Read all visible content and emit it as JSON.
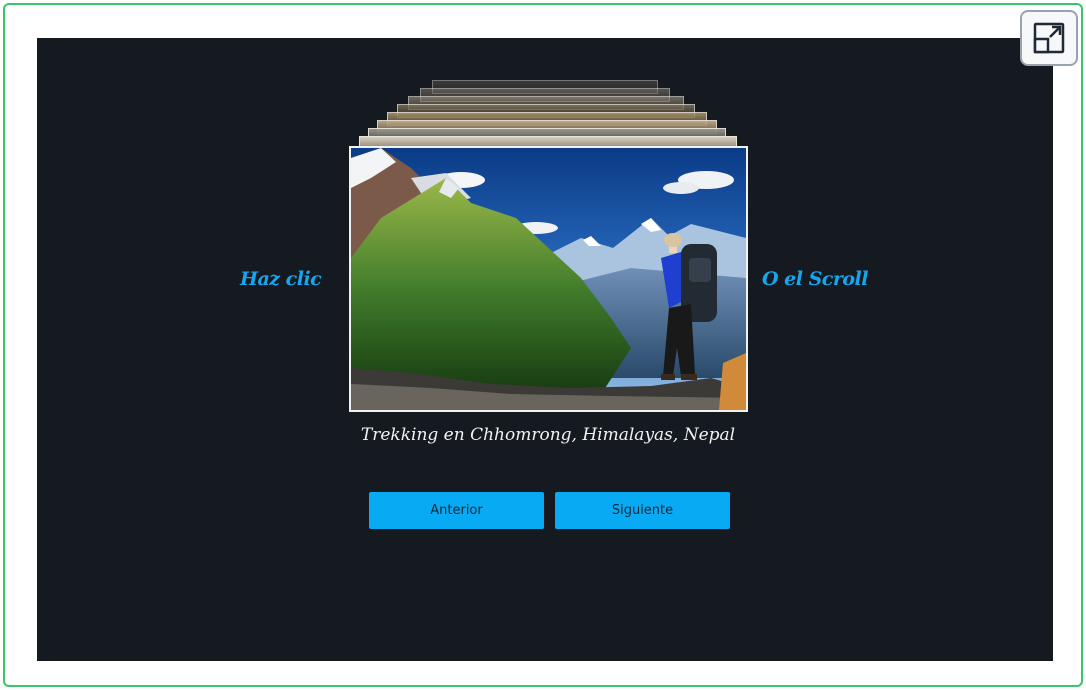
{
  "slideshow": {
    "hint_left": "Haz clic",
    "hint_right": "O el Scroll",
    "caption": "Trekking en Chhomrong, Himalayas, Nepal",
    "prev_label": "Anterior",
    "next_label": "Siguiente"
  },
  "controls": {
    "fullscreen_icon": "expand-arrow-icon"
  },
  "colors": {
    "frame_border": "#3cc46a",
    "stage_bg": "#151a20",
    "accent": "#09aaf4",
    "hint_text": "#16a6ef"
  }
}
